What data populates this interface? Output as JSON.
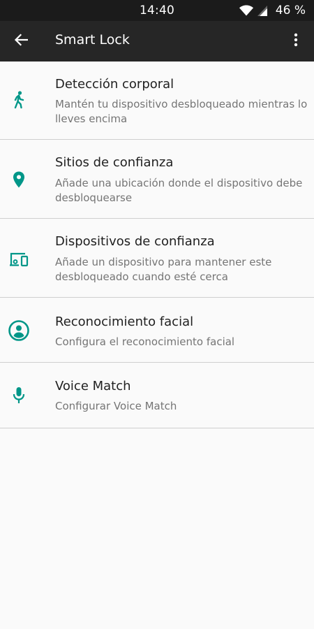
{
  "status_bar": {
    "time": "14:40",
    "battery": "46 %"
  },
  "app_bar": {
    "title": "Smart Lock",
    "back_icon": "arrow-back-icon",
    "menu_icon": "more-vert-icon"
  },
  "accent_color": "#009688",
  "items": [
    {
      "title": "Detección corporal",
      "subtitle": "Mantén tu dispositivo desbloqueado mientras lo lleves encima",
      "icon": "walking-person-icon"
    },
    {
      "title": "Sitios de confianza",
      "subtitle": "Añade una ubicación donde el dispositivo debe desbloquearse",
      "icon": "location-pin-icon"
    },
    {
      "title": "Dispositivos de confianza",
      "subtitle": "Añade un dispositivo para mantener este desbloqueado cuando esté cerca",
      "icon": "devices-icon"
    },
    {
      "title": "Reconocimiento facial",
      "subtitle": "Configura el reconocimiento facial",
      "icon": "face-icon"
    },
    {
      "title": "Voice Match",
      "subtitle": "Configurar Voice Match",
      "icon": "microphone-icon"
    }
  ]
}
